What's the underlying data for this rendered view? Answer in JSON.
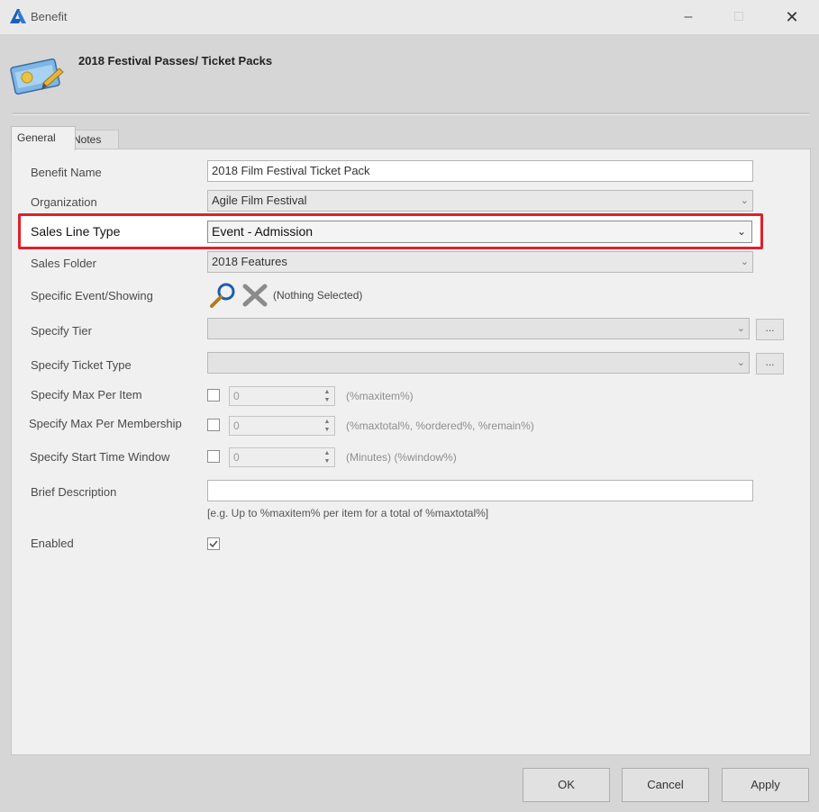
{
  "window": {
    "title": "Benefit"
  },
  "header": {
    "title": "2018 Festival Passes/ Ticket Packs"
  },
  "tabs": [
    {
      "label": "General"
    },
    {
      "label": "Notes"
    }
  ],
  "form": {
    "benefit_name": {
      "label": "Benefit Name",
      "value": "2018 Film Festival Ticket Pack"
    },
    "organization": {
      "label": "Organization",
      "value": "Agile Film Festival"
    },
    "sales_line_type": {
      "label": "Sales Line Type",
      "value": "Event - Admission"
    },
    "sales_folder": {
      "label": "Sales Folder",
      "value": "2018 Features"
    },
    "specific_event": {
      "label": "Specific Event/Showing",
      "value": "(Nothing Selected)"
    },
    "specify_tier": {
      "label": "Specify Tier",
      "value": "",
      "button": "..."
    },
    "specify_ticket_type": {
      "label": "Specify Ticket Type",
      "value": "",
      "button": "..."
    },
    "max_per_item": {
      "label": "Specify Max Per Item",
      "value": "0",
      "hint": "(%maxitem%)"
    },
    "max_per_membership": {
      "label": "Specify Max Per Membership",
      "value": "0",
      "hint": "(%maxtotal%, %ordered%, %remain%)"
    },
    "start_time_window": {
      "label": "Specify Start Time Window",
      "value": "0",
      "hint": "(Minutes) (%window%)"
    },
    "brief_description": {
      "label": "Brief Description",
      "value": "",
      "example": "[e.g. Up to %maxitem% per item for a total of %maxtotal%]"
    },
    "enabled": {
      "label": "Enabled",
      "checked": true
    }
  },
  "buttons": {
    "ok": "OK",
    "cancel": "Cancel",
    "apply": "Apply"
  },
  "colors": {
    "highlight": "#e0202a",
    "background": "#d6d6d6"
  }
}
